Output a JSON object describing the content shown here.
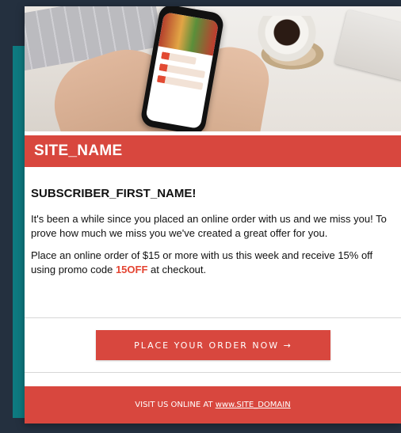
{
  "site": {
    "name": "SITE_NAME"
  },
  "email": {
    "greeting": "SUBSCRIBER_FIRST_NAME!",
    "paragraph1": "It's been a while since you placed an online order with us and we miss you! To prove how much we miss you we've created a great offer for you.",
    "paragraph2_before": "Place an online order of $15 or more with us this week and receive 15% off using promo code ",
    "promo_code": "15OFF",
    "paragraph2_after": " at checkout.",
    "cta_label": "PLACE YOUR ORDER NOW →",
    "footer_prefix": "VISIT US ONLINE AT ",
    "footer_link": "www.SITE_DOMAIN"
  },
  "colors": {
    "accent": "#d8473e",
    "promo": "#e44432",
    "background": "#24303f",
    "teal": "#0e7a80"
  },
  "icons": {
    "hero_image": "phone-in-hands-image"
  }
}
